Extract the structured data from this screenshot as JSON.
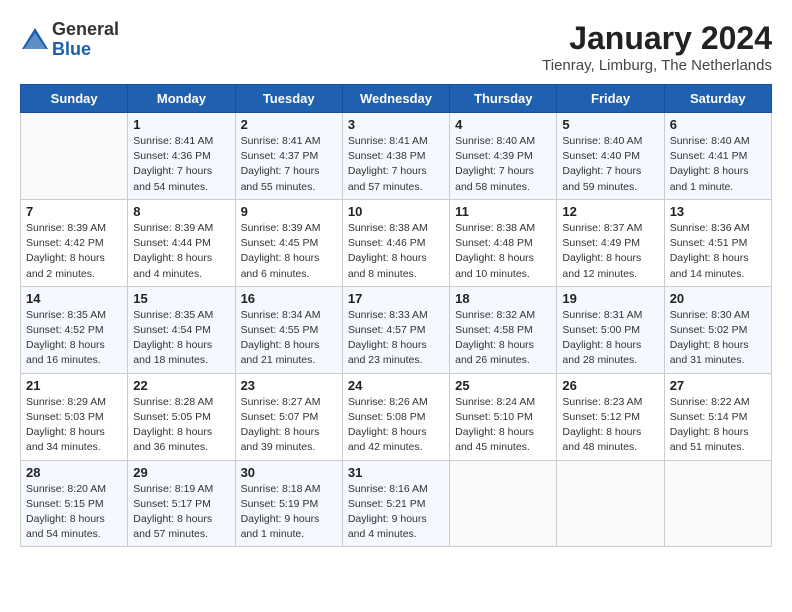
{
  "logo": {
    "general": "General",
    "blue": "Blue"
  },
  "title": {
    "month_year": "January 2024",
    "location": "Tienray, Limburg, The Netherlands"
  },
  "days_of_week": [
    "Sunday",
    "Monday",
    "Tuesday",
    "Wednesday",
    "Thursday",
    "Friday",
    "Saturday"
  ],
  "weeks": [
    [
      {
        "day": "",
        "sunrise": "",
        "sunset": "",
        "daylight": ""
      },
      {
        "day": "1",
        "sunrise": "Sunrise: 8:41 AM",
        "sunset": "Sunset: 4:36 PM",
        "daylight": "Daylight: 7 hours and 54 minutes."
      },
      {
        "day": "2",
        "sunrise": "Sunrise: 8:41 AM",
        "sunset": "Sunset: 4:37 PM",
        "daylight": "Daylight: 7 hours and 55 minutes."
      },
      {
        "day": "3",
        "sunrise": "Sunrise: 8:41 AM",
        "sunset": "Sunset: 4:38 PM",
        "daylight": "Daylight: 7 hours and 57 minutes."
      },
      {
        "day": "4",
        "sunrise": "Sunrise: 8:40 AM",
        "sunset": "Sunset: 4:39 PM",
        "daylight": "Daylight: 7 hours and 58 minutes."
      },
      {
        "day": "5",
        "sunrise": "Sunrise: 8:40 AM",
        "sunset": "Sunset: 4:40 PM",
        "daylight": "Daylight: 7 hours and 59 minutes."
      },
      {
        "day": "6",
        "sunrise": "Sunrise: 8:40 AM",
        "sunset": "Sunset: 4:41 PM",
        "daylight": "Daylight: 8 hours and 1 minute."
      }
    ],
    [
      {
        "day": "7",
        "sunrise": "Sunrise: 8:39 AM",
        "sunset": "Sunset: 4:42 PM",
        "daylight": "Daylight: 8 hours and 2 minutes."
      },
      {
        "day": "8",
        "sunrise": "Sunrise: 8:39 AM",
        "sunset": "Sunset: 4:44 PM",
        "daylight": "Daylight: 8 hours and 4 minutes."
      },
      {
        "day": "9",
        "sunrise": "Sunrise: 8:39 AM",
        "sunset": "Sunset: 4:45 PM",
        "daylight": "Daylight: 8 hours and 6 minutes."
      },
      {
        "day": "10",
        "sunrise": "Sunrise: 8:38 AM",
        "sunset": "Sunset: 4:46 PM",
        "daylight": "Daylight: 8 hours and 8 minutes."
      },
      {
        "day": "11",
        "sunrise": "Sunrise: 8:38 AM",
        "sunset": "Sunset: 4:48 PM",
        "daylight": "Daylight: 8 hours and 10 minutes."
      },
      {
        "day": "12",
        "sunrise": "Sunrise: 8:37 AM",
        "sunset": "Sunset: 4:49 PM",
        "daylight": "Daylight: 8 hours and 12 minutes."
      },
      {
        "day": "13",
        "sunrise": "Sunrise: 8:36 AM",
        "sunset": "Sunset: 4:51 PM",
        "daylight": "Daylight: 8 hours and 14 minutes."
      }
    ],
    [
      {
        "day": "14",
        "sunrise": "Sunrise: 8:35 AM",
        "sunset": "Sunset: 4:52 PM",
        "daylight": "Daylight: 8 hours and 16 minutes."
      },
      {
        "day": "15",
        "sunrise": "Sunrise: 8:35 AM",
        "sunset": "Sunset: 4:54 PM",
        "daylight": "Daylight: 8 hours and 18 minutes."
      },
      {
        "day": "16",
        "sunrise": "Sunrise: 8:34 AM",
        "sunset": "Sunset: 4:55 PM",
        "daylight": "Daylight: 8 hours and 21 minutes."
      },
      {
        "day": "17",
        "sunrise": "Sunrise: 8:33 AM",
        "sunset": "Sunset: 4:57 PM",
        "daylight": "Daylight: 8 hours and 23 minutes."
      },
      {
        "day": "18",
        "sunrise": "Sunrise: 8:32 AM",
        "sunset": "Sunset: 4:58 PM",
        "daylight": "Daylight: 8 hours and 26 minutes."
      },
      {
        "day": "19",
        "sunrise": "Sunrise: 8:31 AM",
        "sunset": "Sunset: 5:00 PM",
        "daylight": "Daylight: 8 hours and 28 minutes."
      },
      {
        "day": "20",
        "sunrise": "Sunrise: 8:30 AM",
        "sunset": "Sunset: 5:02 PM",
        "daylight": "Daylight: 8 hours and 31 minutes."
      }
    ],
    [
      {
        "day": "21",
        "sunrise": "Sunrise: 8:29 AM",
        "sunset": "Sunset: 5:03 PM",
        "daylight": "Daylight: 8 hours and 34 minutes."
      },
      {
        "day": "22",
        "sunrise": "Sunrise: 8:28 AM",
        "sunset": "Sunset: 5:05 PM",
        "daylight": "Daylight: 8 hours and 36 minutes."
      },
      {
        "day": "23",
        "sunrise": "Sunrise: 8:27 AM",
        "sunset": "Sunset: 5:07 PM",
        "daylight": "Daylight: 8 hours and 39 minutes."
      },
      {
        "day": "24",
        "sunrise": "Sunrise: 8:26 AM",
        "sunset": "Sunset: 5:08 PM",
        "daylight": "Daylight: 8 hours and 42 minutes."
      },
      {
        "day": "25",
        "sunrise": "Sunrise: 8:24 AM",
        "sunset": "Sunset: 5:10 PM",
        "daylight": "Daylight: 8 hours and 45 minutes."
      },
      {
        "day": "26",
        "sunrise": "Sunrise: 8:23 AM",
        "sunset": "Sunset: 5:12 PM",
        "daylight": "Daylight: 8 hours and 48 minutes."
      },
      {
        "day": "27",
        "sunrise": "Sunrise: 8:22 AM",
        "sunset": "Sunset: 5:14 PM",
        "daylight": "Daylight: 8 hours and 51 minutes."
      }
    ],
    [
      {
        "day": "28",
        "sunrise": "Sunrise: 8:20 AM",
        "sunset": "Sunset: 5:15 PM",
        "daylight": "Daylight: 8 hours and 54 minutes."
      },
      {
        "day": "29",
        "sunrise": "Sunrise: 8:19 AM",
        "sunset": "Sunset: 5:17 PM",
        "daylight": "Daylight: 8 hours and 57 minutes."
      },
      {
        "day": "30",
        "sunrise": "Sunrise: 8:18 AM",
        "sunset": "Sunset: 5:19 PM",
        "daylight": "Daylight: 9 hours and 1 minute."
      },
      {
        "day": "31",
        "sunrise": "Sunrise: 8:16 AM",
        "sunset": "Sunset: 5:21 PM",
        "daylight": "Daylight: 9 hours and 4 minutes."
      },
      {
        "day": "",
        "sunrise": "",
        "sunset": "",
        "daylight": ""
      },
      {
        "day": "",
        "sunrise": "",
        "sunset": "",
        "daylight": ""
      },
      {
        "day": "",
        "sunrise": "",
        "sunset": "",
        "daylight": ""
      }
    ]
  ]
}
